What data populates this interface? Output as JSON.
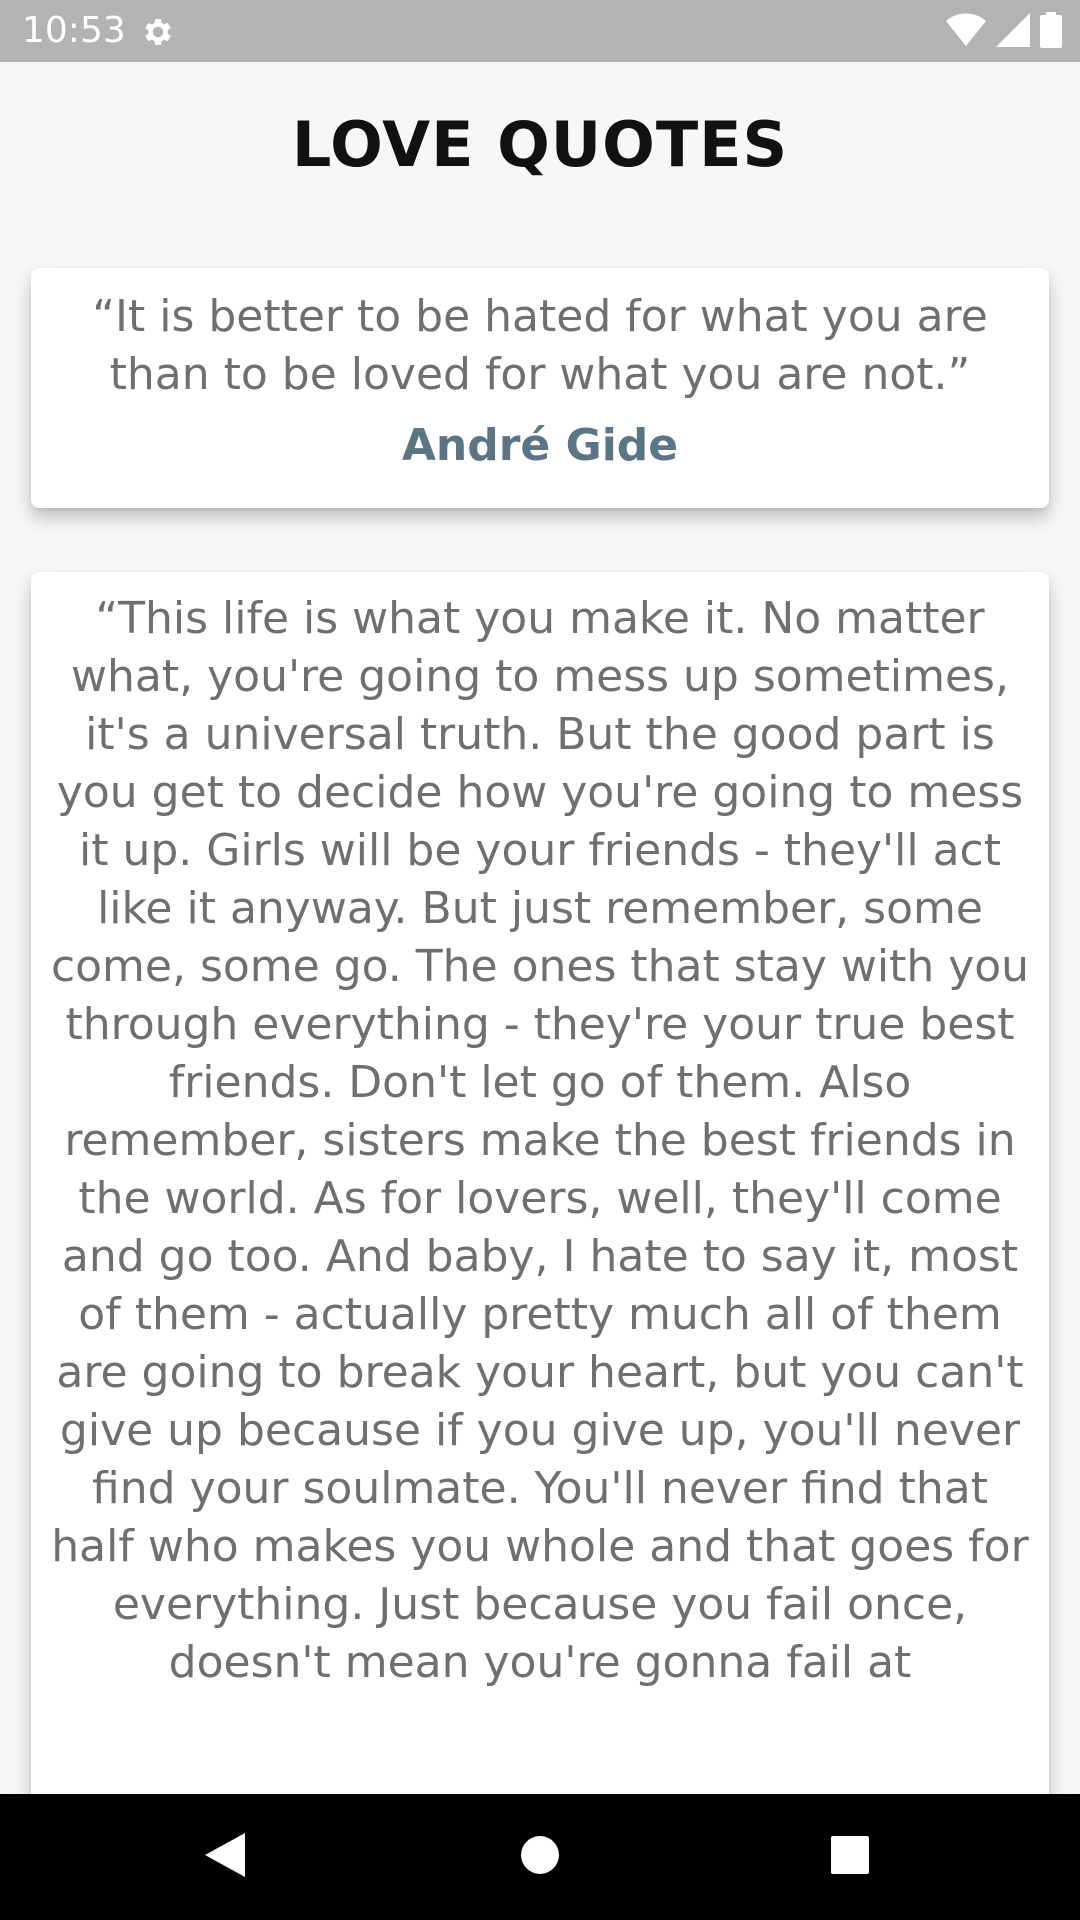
{
  "status_bar": {
    "time": "10:53",
    "icons": [
      "settings-gear-icon",
      "wifi-icon",
      "cellular-signal-icon",
      "battery-icon"
    ]
  },
  "header": {
    "title": "LOVE QUOTES"
  },
  "quotes": [
    {
      "text": "“It is better to be hated for what you are than to be loved for what you are not.”",
      "author": "André Gide"
    },
    {
      "text": "“This life is what you make it. No matter what, you're going to mess up sometimes, it's a universal truth. But the good part is you get to decide how you're going to mess it up. Girls will be your friends - they'll act like it anyway. But just remember, some come, some go. The ones that stay with you through everything - they're your true best friends. Don't let go of them. Also remember, sisters make the best friends in the world. As for lovers, well, they'll come and go too. And baby, I hate to say it, most of them - actually pretty much all of them are going to break your heart, but you can't give up because if you give up, you'll never find your soulmate. You'll never find that half who makes you whole and that goes for everything. Just because you fail once, doesn't mean you're gonna fail at"
    }
  ],
  "nav_bar": {
    "icons": [
      "back-icon",
      "home-icon",
      "recents-icon"
    ]
  },
  "colors": {
    "status_bar": "#b3b3b3",
    "background": "#f7f7f7",
    "title": "#111111",
    "quote_text": "#6f6f6f",
    "author": "#5b7585",
    "nav_bar": "#000000"
  }
}
